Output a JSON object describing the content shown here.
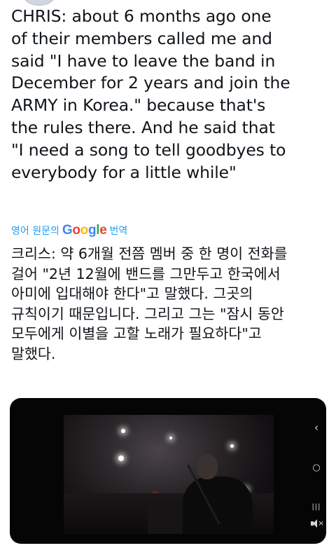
{
  "tweet": {
    "text": "CHRIS: about 6 months ago one\nof their members called me and\nsaid \"I have to leave the band in\nDecember for 2 years and join the\nARMY in Korea.\" because that's\nthe rules there. And he said that\n\"I need a song to tell goodbyes to\neverybody for a little while\"",
    "translate": {
      "prefix": "영어 원문의",
      "google": [
        "G",
        "o",
        "o",
        "g",
        "l",
        "e"
      ],
      "suffix": "번역"
    },
    "translated_text": "크리스: 약 6개월 전쯤 멤버 중 한 명이 전화를\n걸어 \"2년 12월에 밴드를 그만두고 한국에서\n아미에 입대해야 한다\"고 말했다. 그곳의\n규칙이기 때문입니다. 그리고 그는 \"잠시 동안\n모두에게 이별을 고할 노래가 필요하다\"고\n말했다."
  },
  "video": {
    "controls": {
      "back": "‹",
      "home": "○",
      "recent": "|||"
    },
    "icons": [
      "chevron-left-icon",
      "home-circle-icon",
      "recent-apps-icon",
      "mute-icon"
    ]
  },
  "colors": {
    "link": "#1d9bf0",
    "text": "#0f1419",
    "video_bg": "#050505"
  }
}
